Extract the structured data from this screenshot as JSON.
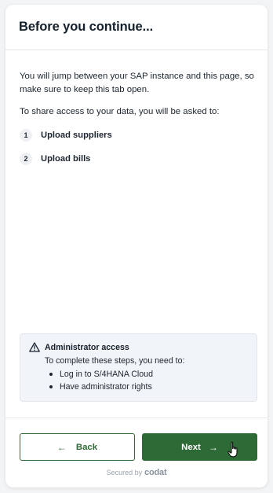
{
  "header": {
    "title": "Before you continue..."
  },
  "content": {
    "intro": "You will jump between your SAP instance and this page, so make sure to keep this tab open.",
    "share_text": "To share access to your data, you will be asked to:",
    "steps": [
      {
        "number": "1",
        "label": "Upload suppliers"
      },
      {
        "number": "2",
        "label": "Upload bills"
      }
    ]
  },
  "notice": {
    "icon": "warning-triangle-icon",
    "title": "Administrator access",
    "text": "To complete these steps, you need to:",
    "items": [
      "Log in to S/4HANA Cloud",
      "Have administrator rights"
    ]
  },
  "actions": {
    "back_label": "Back",
    "back_arrow": "←",
    "next_label": "Next",
    "next_arrow": "→"
  },
  "footer": {
    "secured_text": "Secured by",
    "brand": "codat"
  },
  "colors": {
    "primary": "#2e6a36",
    "notice_bg": "#f1f4f8",
    "text": "#16202c"
  }
}
